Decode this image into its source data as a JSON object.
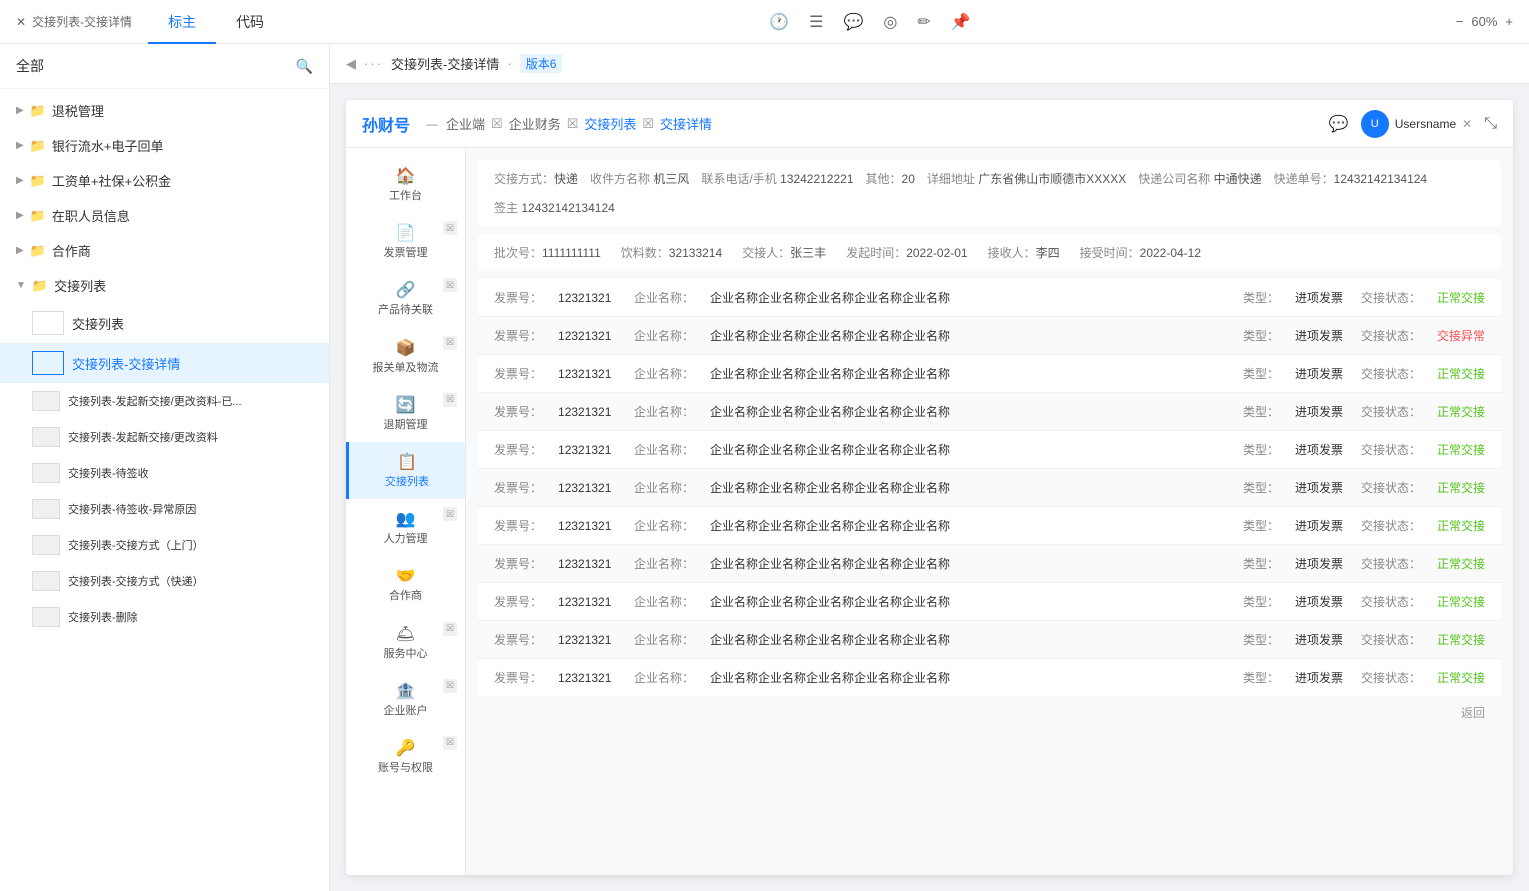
{
  "topbar": {
    "close_label": "交接列表-交接详情",
    "tab_main": "标主",
    "tab_code": "代码",
    "zoom": "60%",
    "icons": [
      "history",
      "document",
      "comment",
      "target",
      "brush",
      "pin"
    ]
  },
  "sidebar": {
    "header_label": "全部",
    "groups": [
      {
        "name": "退税管理",
        "expanded": false,
        "items": []
      },
      {
        "name": "银行流水+电子回单",
        "expanded": false,
        "items": []
      },
      {
        "name": "工资单+社保+公积金",
        "expanded": false,
        "items": []
      },
      {
        "name": "在职人员信息",
        "expanded": false,
        "items": []
      },
      {
        "name": "合作商",
        "expanded": false,
        "items": []
      },
      {
        "name": "交接列表",
        "expanded": true,
        "items": [
          {
            "label": "交接列表",
            "active": false,
            "indent": 1
          },
          {
            "label": "交接列表-交接详情",
            "active": true,
            "indent": 1
          },
          {
            "label": "交接列表-发起新交接/更改资料-已...",
            "active": false,
            "indent": 1
          },
          {
            "label": "交接列表-发起新交接/更改资料",
            "active": false,
            "indent": 1
          },
          {
            "label": "交接列表-待签收",
            "active": false,
            "indent": 1
          },
          {
            "label": "交接列表-待签收-异常原因",
            "active": false,
            "indent": 1
          },
          {
            "label": "交接列表-交接方式（上门）",
            "active": false,
            "indent": 1
          },
          {
            "label": "交接列表-交接方式（快递）",
            "active": false,
            "indent": 1
          },
          {
            "label": "交接列表-删除",
            "active": false,
            "indent": 1
          }
        ]
      }
    ]
  },
  "doc_header": {
    "dots": "···",
    "title": "交接列表-交接详情",
    "version": "版本6"
  },
  "app_nav": {
    "brand": "孙财号",
    "breadcrumb": [
      "企业端",
      "企业财务",
      "交接列表",
      "交接详情"
    ],
    "username": "Usersname"
  },
  "app_sidebar_items": [
    {
      "label": "工作台",
      "icon": "🏠",
      "active": false,
      "has_tag": false
    },
    {
      "label": "发票管理",
      "icon": "📄",
      "active": false,
      "has_tag": true
    },
    {
      "label": "产品待关联",
      "icon": "🔗",
      "active": false,
      "has_tag": true
    },
    {
      "label": "报关单及物流",
      "icon": "📦",
      "active": false,
      "has_tag": true
    },
    {
      "label": "退期管理",
      "icon": "🔄",
      "active": false,
      "has_tag": true
    },
    {
      "label": "交接列表",
      "icon": "📋",
      "active": true,
      "has_tag": false
    },
    {
      "label": "人力管理",
      "icon": "👥",
      "active": false,
      "has_tag": true
    },
    {
      "label": "合作商",
      "icon": "🤝",
      "active": false,
      "has_tag": false
    },
    {
      "label": "服务中心",
      "icon": "🛎",
      "active": false,
      "has_tag": true
    },
    {
      "label": "企业账户",
      "icon": "🏦",
      "active": false,
      "has_tag": true
    },
    {
      "label": "账号与权限",
      "icon": "🔑",
      "active": false,
      "has_tag": true
    }
  ],
  "info_bar": {
    "fields": [
      {
        "label": "交接方式：",
        "value": "快递"
      },
      {
        "label": "收件方名称",
        "value": "机三风"
      },
      {
        "label": "联系电话/手机",
        "value": "13242212221"
      },
      {
        "label": "其他：",
        "value": "20"
      },
      {
        "label": "详细地址",
        "value": "广东省佛山市顺德市XXXXX"
      },
      {
        "label": "快递公司名称",
        "value": "中通快递"
      },
      {
        "label": "快递单号：",
        "value": "12432142134124"
      },
      {
        "label": "签主",
        "value": "12432142134124"
      }
    ]
  },
  "batch_info": {
    "fields": [
      {
        "label": "批次号：",
        "value": "1111111111"
      },
      {
        "label": "饮料数：",
        "value": "32133214"
      },
      {
        "label": "交接人：",
        "value": "张三丰"
      },
      {
        "label": "发起时间：",
        "value": "2022-02-01"
      },
      {
        "label": "接收人：",
        "value": "李四"
      },
      {
        "label": "接受时间：",
        "value": "2022-04-12"
      }
    ]
  },
  "records": [
    {
      "invoice_no": "12321321",
      "company": "企业名称企业名称企业名称企业名称企业名称",
      "type": "进项发票",
      "status": "正常交接",
      "status_type": "normal"
    },
    {
      "invoice_no": "12321321",
      "company": "企业名称企业名称企业名称企业名称企业名称",
      "type": "进项发票",
      "status": "交接异常",
      "status_type": "error"
    },
    {
      "invoice_no": "12321321",
      "company": "企业名称企业名称企业名称企业名称企业名称",
      "type": "进项发票",
      "status": "正常交接",
      "status_type": "normal"
    },
    {
      "invoice_no": "12321321",
      "company": "企业名称企业名称企业名称企业名称企业名称",
      "type": "进项发票",
      "status": "正常交接",
      "status_type": "normal"
    },
    {
      "invoice_no": "12321321",
      "company": "企业名称企业名称企业名称企业名称企业名称",
      "type": "进项发票",
      "status": "正常交接",
      "status_type": "normal"
    },
    {
      "invoice_no": "12321321",
      "company": "企业名称企业名称企业名称企业名称企业名称",
      "type": "进项发票",
      "status": "正常交接",
      "status_type": "normal"
    },
    {
      "invoice_no": "12321321",
      "company": "企业名称企业名称企业名称企业名称企业名称",
      "type": "进项发票",
      "status": "正常交接",
      "status_type": "normal"
    },
    {
      "invoice_no": "12321321",
      "company": "企业名称企业名称企业名称企业名称企业名称",
      "type": "进项发票",
      "status": "正常交接",
      "status_type": "normal"
    },
    {
      "invoice_no": "12321321",
      "company": "企业名称企业名称企业名称企业名称企业名称",
      "type": "进项发票",
      "status": "正常交接",
      "status_type": "normal"
    },
    {
      "invoice_no": "12321321",
      "company": "企业名称企业名称企业名称企业名称企业名称",
      "type": "进项发票",
      "status": "正常交接",
      "status_type": "normal"
    },
    {
      "invoice_no": "12321321",
      "company": "企业名称企业名称企业名称企业名称企业名称",
      "type": "进项发票",
      "status": "正常交接",
      "status_type": "normal"
    }
  ],
  "pagination": "返回",
  "labels": {
    "invoice_label": "发票号：",
    "company_label": "企业名称：",
    "type_label": "类型：",
    "status_label": "交接状态："
  }
}
